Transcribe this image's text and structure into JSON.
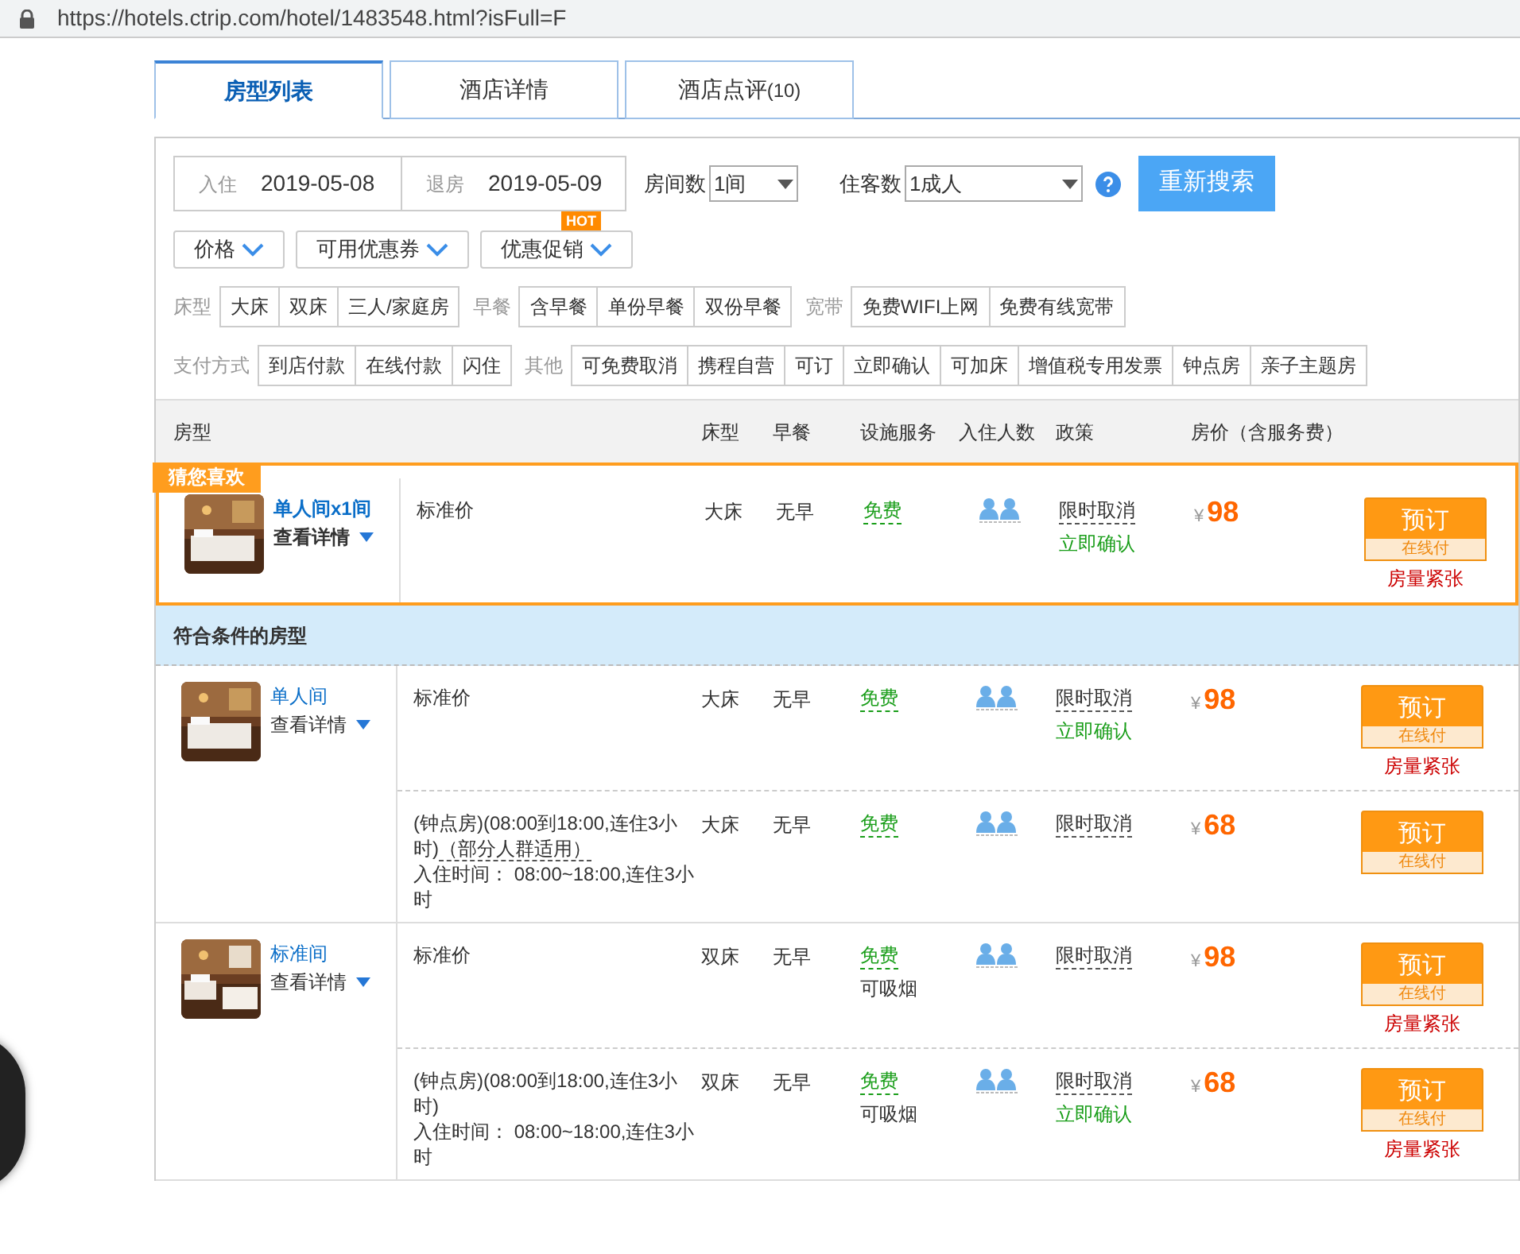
{
  "address_bar": {
    "url": "https://hotels.ctrip.com/hotel/1483548.html?isFull=F"
  },
  "tabs": [
    {
      "label": "房型列表",
      "selected": true
    },
    {
      "label": "酒店详情",
      "selected": false
    },
    {
      "label": "酒店点评",
      "count": "(10)",
      "selected": false
    }
  ],
  "search": {
    "checkin_label": "入住",
    "checkin": "2019-05-08",
    "checkout_label": "退房",
    "checkout": "2019-05-09",
    "rooms_label": "房间数",
    "rooms": "1间",
    "guests_label": "住客数",
    "guests": "1成人",
    "button": "重新搜索"
  },
  "dropdown_filters": [
    {
      "label": "价格"
    },
    {
      "label": "可用优惠券"
    },
    {
      "label": "优惠促销",
      "badge": "HOT"
    }
  ],
  "filter_rows": [
    [
      {
        "label": "床型",
        "options": [
          "大床",
          "双床",
          "三人/家庭房"
        ]
      },
      {
        "label": "早餐",
        "options": [
          "含早餐",
          "单份早餐",
          "双份早餐"
        ]
      },
      {
        "label": "宽带",
        "options": [
          "免费WIFI上网",
          "免费有线宽带"
        ]
      }
    ],
    [
      {
        "label": "支付方式",
        "options": [
          "到店付款",
          "在线付款",
          "闪住"
        ]
      },
      {
        "label": "其他",
        "options": [
          "可免费取消",
          "携程自营",
          "可订",
          "立即确认",
          "可加床",
          "增值税专用发票",
          "钟点房",
          "亲子主题房"
        ]
      }
    ]
  ],
  "table": {
    "columns": [
      "房型",
      "床型",
      "早餐",
      "设施服务",
      "入住人数",
      "政策",
      "房价（含服务费）"
    ],
    "featured": {
      "badge": "猜您喜欢",
      "name": "单人间x1间",
      "details_link": "查看详情",
      "rates": [
        {
          "description": "标准价",
          "bed": "大床",
          "breakfast": "无早",
          "facility": "免费",
          "policy": "限时取消",
          "confirm": "立即确认",
          "currency": "¥",
          "price": "98",
          "book_button": "预订",
          "payment": "在线付",
          "scarcity": "房量紧张"
        }
      ]
    },
    "section_title": "符合条件的房型",
    "rooms": [
      {
        "name": "单人间",
        "details_link": "查看详情",
        "rates": [
          {
            "description": "标准价",
            "bed": "大床",
            "breakfast": "无早",
            "facility": "免费",
            "policy": "限时取消",
            "confirm": "立即确认",
            "currency": "¥",
            "price": "98",
            "book_button": "预订",
            "payment": "在线付",
            "scarcity": "房量紧张"
          },
          {
            "description": "(钟点房)(08:00到18:00,连住3小时)",
            "note": "（部分人群适用）",
            "checkin_time": "入住时间： 08:00~18:00,连住3小时",
            "bed": "大床",
            "breakfast": "无早",
            "facility": "免费",
            "policy": "限时取消",
            "currency": "¥",
            "price": "68",
            "book_button": "预订",
            "payment": "在线付"
          }
        ]
      },
      {
        "name": "标准间",
        "details_link": "查看详情",
        "rates": [
          {
            "description": "标准价",
            "bed": "双床",
            "breakfast": "无早",
            "facility": "免费",
            "facility_note": "可吸烟",
            "policy": "限时取消",
            "currency": "¥",
            "price": "98",
            "book_button": "预订",
            "payment": "在线付",
            "scarcity": "房量紧张"
          },
          {
            "description": "(钟点房)(08:00到18:00,连住3小时)",
            "checkin_time": "入住时间： 08:00~18:00,连住3小时",
            "bed": "双床",
            "breakfast": "无早",
            "facility": "免费",
            "facility_note": "可吸烟",
            "policy": "限时取消",
            "confirm": "立即确认",
            "currency": "¥",
            "price": "68",
            "book_button": "预订",
            "payment": "在线付",
            "scarcity": "房量紧张"
          }
        ]
      }
    ]
  }
}
